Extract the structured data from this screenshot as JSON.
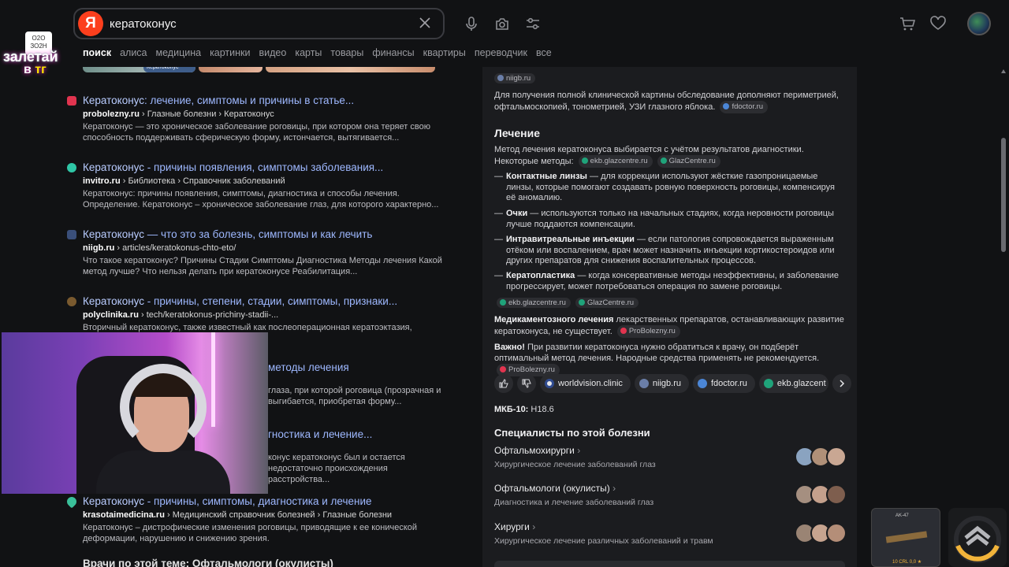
{
  "search": {
    "logo_letter": "Я",
    "query": "кератоконус"
  },
  "tabs": [
    "поиск",
    "алиса",
    "медицина",
    "картинки",
    "видео",
    "карты",
    "товары",
    "финансы",
    "квартиры",
    "переводчик",
    "все"
  ],
  "thumb_caption": "Кератоконус",
  "stream_logo": {
    "badge": "О2О ЗО2Н",
    "line1": "залетай",
    "line2_prefix": "в ",
    "line2_accent": "тг"
  },
  "results": [
    {
      "title_bold": "Кератоконус",
      "title_rest": ": лечение, симптомы и причины в статье...",
      "domain": "probolezny.ru",
      "path": " › Глазные болезни › Кератоконус",
      "snippet": "Кератоконус — это хроническое заболевание роговицы, при котором она теряет свою способность поддерживать сферическую форму, истончается, вытягивается...",
      "fav_color": "#e1344f"
    },
    {
      "title_bold": "Кератоконус",
      "title_rest": " - причины появления, симптомы заболевания...",
      "domain": "invitro.ru",
      "path": " › Библиотека › Справочник заболеваний",
      "snippet": "Кератоконус: причины появления, симптомы, диагностика и способы лечения. Определение. Кератоконус – хроническое заболевание глаз, для которого характерно...",
      "fav_color": "#2fc6a6"
    },
    {
      "title_bold": "Кератоконус",
      "title_rest": " — что это за болезнь, симптомы и как лечить",
      "domain": "niigb.ru",
      "path": " › articles/keratokonus-chto-eto/",
      "snippet": "Что такое кератоконус? Причины Стадии Симптомы Диагностика Методы лечения Какой метод лучше? Что нельзя делать при кератоконусе Реабилитация...",
      "fav_color": "#3a4f7a"
    },
    {
      "title_bold": "Кератоконус",
      "title_rest": " - причины, степени, стадии, симптомы, признаки...",
      "domain": "polyclinika.ru",
      "path": " › tech/keratokonus-prichiny-stadii-...",
      "snippet": "Вторичный кератоконус, также известный как послеоперационная кератоэктазия, ...коррекции зрения. Классификация.",
      "fav_color": "#7a5a2f"
    },
    {
      "title_bold": "",
      "title_rest": "методы лечения",
      "domain": "",
      "path": "",
      "snippet": "глаза, при которой роговица (прозрачная и выгибается, приобретая форму...",
      "fav_color": "#333"
    },
    {
      "title_bold": "",
      "title_rest": "гностика и лечение...",
      "domain": "",
      "path": "",
      "snippet": "конус кератоконус был и остается недостаточно происхождения расстройства...",
      "fav_color": "#333"
    },
    {
      "title_bold": "Кератоконус",
      "title_rest": " - причины, симптомы, диагностика и лечение",
      "domain": "krasotaimedicina.ru",
      "path": " › Медицинский справочник болезней › Глазные болезни",
      "snippet": "Кератоконус – дистрофические изменения роговицы, приводящие к ее конической деформации, нарушению и снижению зрения.",
      "fav_color": "#3ac09a"
    }
  ],
  "bottom_cut": "Врачи по этой теме: Офтальмологи (окулисты)",
  "panel": {
    "top_chip": "niigb.ru",
    "intro": "Для получения полной клинической картины обследование дополняют периметрией, офтальмоскопией, тонометрией, УЗИ глазного яблока.",
    "intro_chip": "fdoctor.ru",
    "treatment_heading": "Лечение",
    "treatment_text": "Метод лечения кератоконуса выбирается с учётом результатов диагностики. Некоторые методы:",
    "treatment_chips": [
      "ekb.glazcentre.ru",
      "GlazCentre.ru"
    ],
    "methods": [
      {
        "name": "Контактные линзы",
        "text": " — для коррекции используют жёсткие газопроницаемые линзы, которые помогают создавать ровную поверхность роговицы, компенсируя её аномалию."
      },
      {
        "name": "Очки",
        "text": " — используются только на начальных стадиях, когда неровности роговицы лучше поддаются компенсации."
      },
      {
        "name": "Интравитреальные инъекции",
        "text": " — если патология сопровождается выраженным отёком или воспалением, врач может назначить инъекции кортикостероидов или других препаратов для снижения воспалительных процессов."
      },
      {
        "name": "Кератопластика",
        "text": " — когда консервативные методы неэффективны, и заболевание прогрессирует, может потребоваться операция по замене роговицы."
      }
    ],
    "methods_chips": [
      "ekb.glazcentre.ru",
      "GlazCentre.ru"
    ],
    "drug_bold": "Медикаментозного лечения",
    "drug_text": " лекарственных препаратов, останавливающих развитие кератоконуса, не существует.",
    "drug_chip": "ProBolezny.ru",
    "important_bold": "Важно!",
    "important_text": " При развитии кератоконуса нужно обратиться к врачу, он подберёт оптимальный метод лечения. Народные средства применять не рекомендуется.",
    "important_chip": "ProBolezny.ru",
    "sources": [
      "worldvision.clinic",
      "niigb.ru",
      "fdoctor.ru",
      "ekb.glazcent"
    ],
    "mkb_label": "МКБ-10:",
    "mkb_value": " H18.6",
    "specialists_heading": "Специалисты по этой болезни",
    "specialists": [
      {
        "title": "Офтальмохирурги",
        "sub": "Хирургическое лечение заболеваний глаз"
      },
      {
        "title": "Офтальмологи (окулисты)",
        "sub": "Диагностика и лечение заболеваний глаз"
      },
      {
        "title": "Хирурги",
        "sub": "Хирургическое лечение различных заболеваний и травм"
      }
    ]
  },
  "mini_ad": {
    "label": "AK-47",
    "sub": "10 CRL 0,0 ★"
  },
  "colors": {
    "accent_red": "#fc3f1d",
    "link": "#9eb8ff",
    "panel_bg": "#1b1c1f",
    "page_bg": "#111214"
  }
}
